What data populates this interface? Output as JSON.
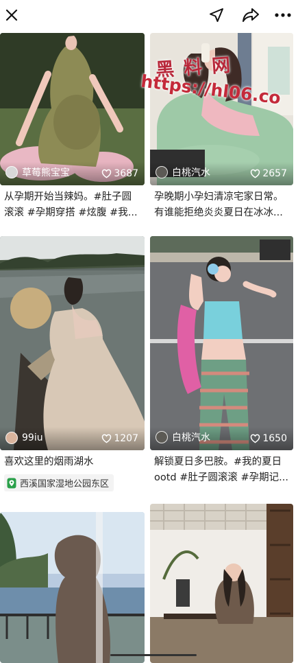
{
  "topbar": {
    "icons": [
      "close-icon",
      "location-arrow-icon",
      "share-icon",
      "more-icon"
    ]
  },
  "watermark": {
    "cn": "黑料网",
    "url": "https://hl06.co"
  },
  "cards": [
    {
      "title": "从孕期开始当辣妈。#肚子圆滚滚 #孕期穿搭 #炫腹 #我...",
      "author": "草莓熊宝宝",
      "likes": "3687"
    },
    {
      "title": "孕晚期小孕妇清凉宅家日常。有谁能拒绝炎炎夏日在冰冰...",
      "author": "白桃汽水",
      "likes": "2657"
    },
    {
      "title": "喜欢这里的烟雨湖水",
      "author": "99iu",
      "likes": "1207",
      "location": "西溪国家湿地公园东区"
    },
    {
      "title": "解锁夏日多巴胺。#我的夏日ootd #肚子圆滚滚 #孕期记...",
      "author": "白桃汽水",
      "likes": "1650"
    },
    {},
    {}
  ],
  "colors": {
    "watermark": "#c42a3a",
    "location_pin": "#2aa04a"
  }
}
